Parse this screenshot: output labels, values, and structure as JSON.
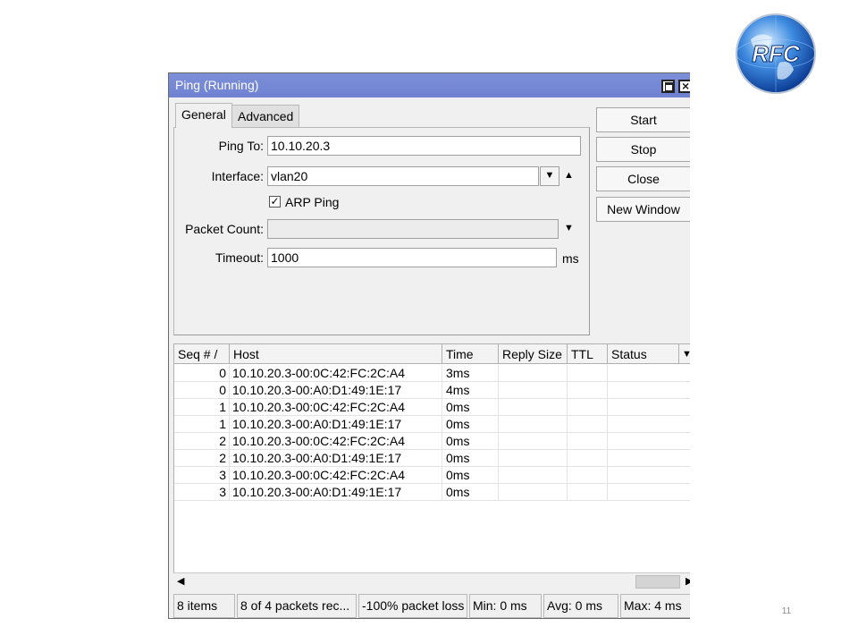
{
  "window": {
    "title": "Ping (Running)",
    "tabs": [
      "General",
      "Advanced"
    ],
    "form": {
      "ping_to_label": "Ping To:",
      "ping_to_value": "10.10.20.3",
      "interface_label": "Interface:",
      "interface_value": "vlan20",
      "arp_ping_label": "ARP Ping",
      "arp_ping_checked": true,
      "packet_count_label": "Packet Count:",
      "packet_count_value": "",
      "timeout_label": "Timeout:",
      "timeout_value": "1000",
      "timeout_unit": "ms"
    },
    "buttons": {
      "start": "Start",
      "stop": "Stop",
      "close": "Close",
      "new_window": "New Window"
    },
    "table": {
      "columns": [
        "Seq # /",
        "Host",
        "Time",
        "Reply Size",
        "TTL",
        "Status"
      ],
      "rows": [
        {
          "seq": "0",
          "host": "10.10.20.3-00:0C:42:FC:2C:A4",
          "time": "3ms",
          "reply": "",
          "ttl": "",
          "status": ""
        },
        {
          "seq": "0",
          "host": "10.10.20.3-00:A0:D1:49:1E:17",
          "time": "4ms",
          "reply": "",
          "ttl": "",
          "status": ""
        },
        {
          "seq": "1",
          "host": "10.10.20.3-00:0C:42:FC:2C:A4",
          "time": "0ms",
          "reply": "",
          "ttl": "",
          "status": ""
        },
        {
          "seq": "1",
          "host": "10.10.20.3-00:A0:D1:49:1E:17",
          "time": "0ms",
          "reply": "",
          "ttl": "",
          "status": ""
        },
        {
          "seq": "2",
          "host": "10.10.20.3-00:0C:42:FC:2C:A4",
          "time": "0ms",
          "reply": "",
          "ttl": "",
          "status": ""
        },
        {
          "seq": "2",
          "host": "10.10.20.3-00:A0:D1:49:1E:17",
          "time": "0ms",
          "reply": "",
          "ttl": "",
          "status": ""
        },
        {
          "seq": "3",
          "host": "10.10.20.3-00:0C:42:FC:2C:A4",
          "time": "0ms",
          "reply": "",
          "ttl": "",
          "status": ""
        },
        {
          "seq": "3",
          "host": "10.10.20.3-00:A0:D1:49:1E:17",
          "time": "0ms",
          "reply": "",
          "ttl": "",
          "status": ""
        }
      ]
    },
    "status_bar": [
      "8 items",
      "8 of 4 packets rec...",
      "-100% packet loss",
      "Min: 0 ms",
      "Avg: 0 ms",
      "Max: 4 ms"
    ]
  },
  "logo": {
    "text": "RFC"
  },
  "page_number": "11",
  "colors": {
    "titlebar": "#7486d4",
    "window_bg": "#f0f0f0",
    "logo_blue": "#1f63c9"
  }
}
